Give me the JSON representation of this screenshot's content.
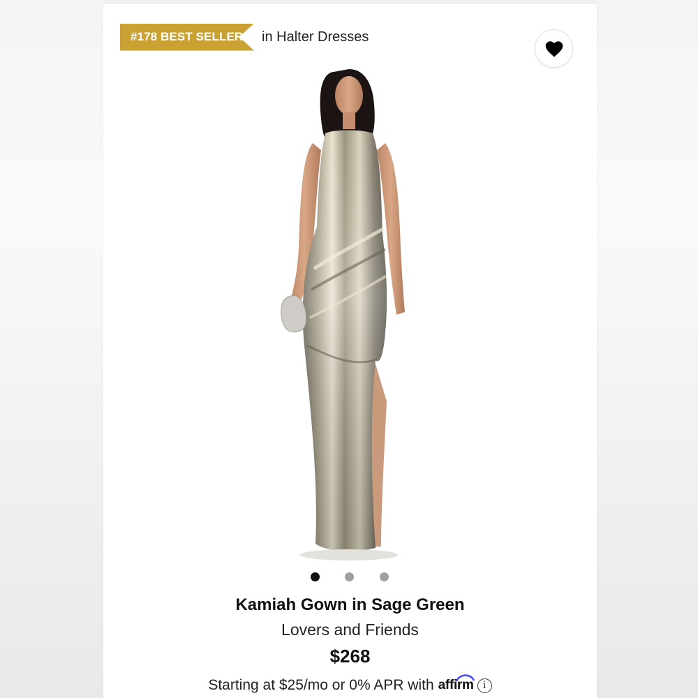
{
  "badge": {
    "label": "#178 BEST SELLER",
    "context": "in Halter Dresses",
    "color": "#c9a233"
  },
  "wishlist": {
    "icon": "heart-icon"
  },
  "carousel": {
    "count": 3,
    "active_index": 0
  },
  "product": {
    "title": "Kamiah Gown in Sage Green",
    "brand": "Lovers and Friends",
    "price": "$268"
  },
  "financing": {
    "text": "Starting at $25/mo or 0% APR with",
    "provider": "affirm",
    "info_icon": "info-icon"
  }
}
